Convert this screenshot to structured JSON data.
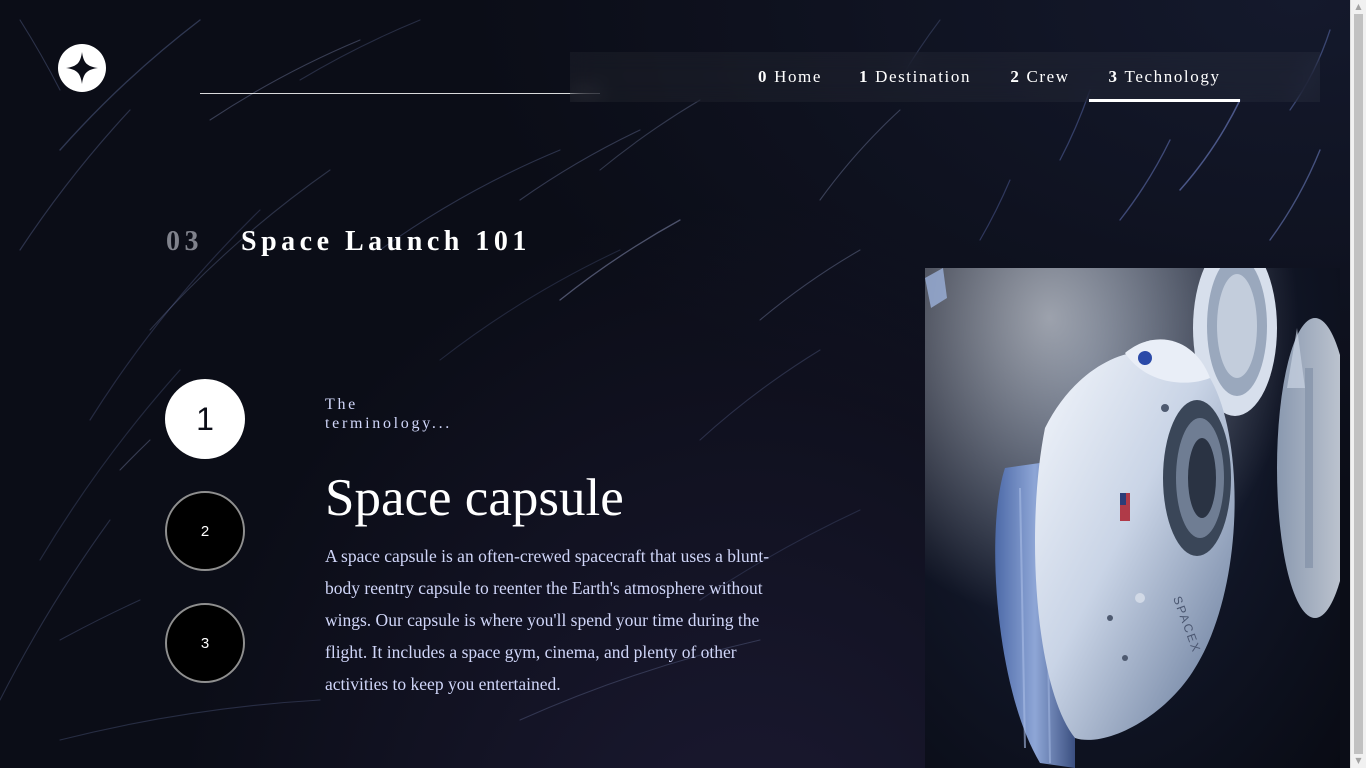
{
  "header": {
    "logo_icon": "star-logo-icon"
  },
  "nav": {
    "items": [
      {
        "num": "0",
        "label": "Home"
      },
      {
        "num": "1",
        "label": "Destination"
      },
      {
        "num": "2",
        "label": "Crew"
      },
      {
        "num": "3",
        "label": "Technology",
        "active": true
      }
    ]
  },
  "section": {
    "number": "03",
    "title": "Space Launch 101"
  },
  "slider": {
    "steps": [
      "1",
      "2",
      "3"
    ],
    "active_step": "1"
  },
  "technology": {
    "eyebrow": "The terminology...",
    "name": "Space capsule",
    "description": "A space capsule is an often-crewed spacecraft that uses a blunt-body reentry capsule to reenter the Earth's atmosphere without wings. Our capsule is where you'll spend your time during the flight. It includes a space gym, cinema, and plenty of other activities to keep you entertained."
  },
  "image": {
    "icon": "space-capsule-image"
  },
  "colors": {
    "background": "#0b0d17",
    "text_light": "#d0d6f9",
    "muted": "#80828c",
    "white": "#ffffff"
  }
}
